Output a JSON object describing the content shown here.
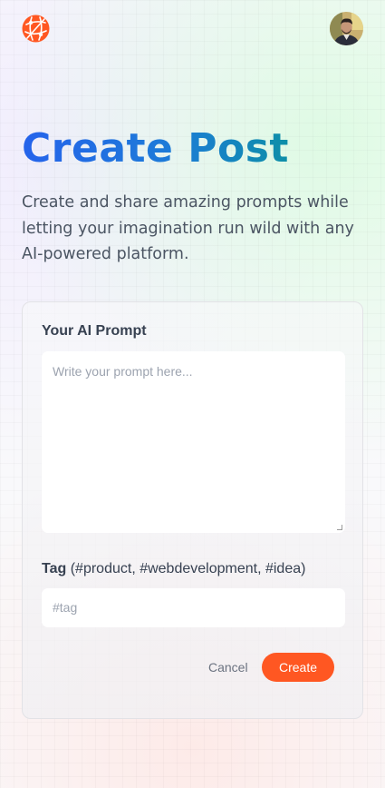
{
  "header": {
    "logo_icon": "globe-logo-icon",
    "avatar_icon": "user-avatar"
  },
  "page": {
    "title": "Create Post",
    "description": "Create and share amazing prompts while letting your imagination run wild with any AI-powered platform."
  },
  "form": {
    "prompt_label": "Your AI Prompt",
    "prompt_placeholder": "Write your prompt here...",
    "tag_label": "Tag",
    "tag_hint": "(#product, #webdevelopment, #idea)",
    "tag_placeholder": "#tag",
    "cancel_label": "Cancel",
    "submit_label": "Create"
  },
  "colors": {
    "accent": "#ff5722",
    "title_gradient_start": "#2563eb",
    "title_gradient_end": "#0e8fa8"
  }
}
